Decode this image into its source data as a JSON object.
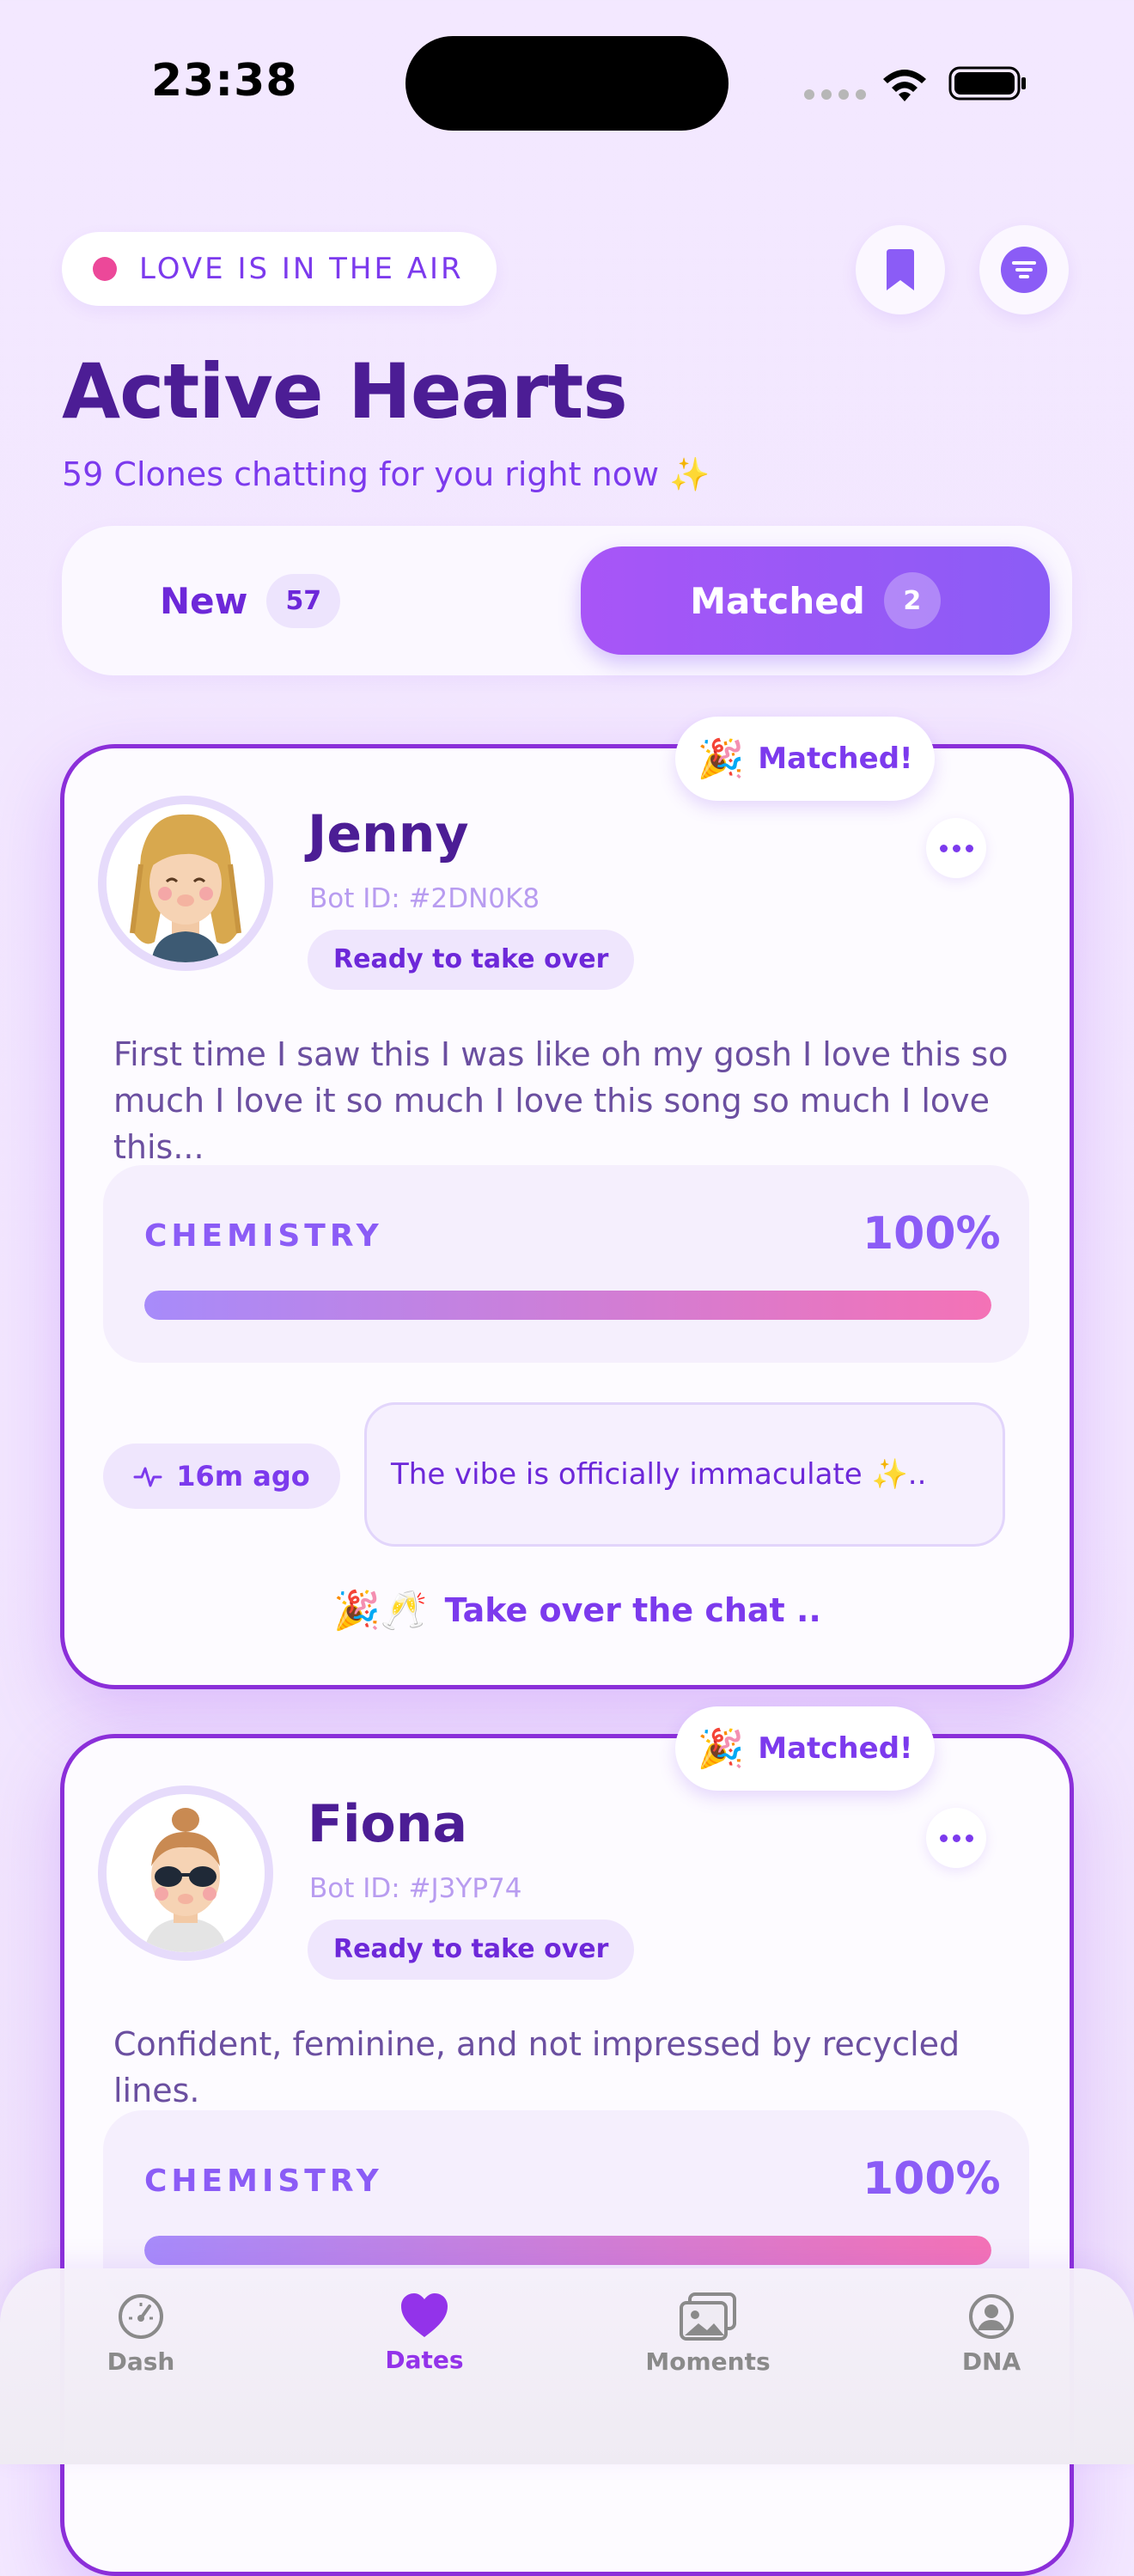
{
  "status_bar": {
    "time": "23:38"
  },
  "header": {
    "tag_label": "LOVE IS IN THE AIR",
    "title": "Active Hearts",
    "subtitle": "59 Clones chatting for you right now ✨"
  },
  "segments": {
    "new_label": "New",
    "new_count": "57",
    "matched_label": "Matched",
    "matched_count": "2"
  },
  "cards": [
    {
      "badge_emoji": "🎉",
      "badge_label": "Matched!",
      "name": "Jenny",
      "bot_id": "Bot ID: #2DN0K8",
      "status": "Ready to take over",
      "description": "First time I saw this I was like oh my gosh I love this so much I love it so much I love this song so much I love this...",
      "chemistry_label": "CHEMISTRY",
      "chemistry_value": "100%",
      "chemistry_fraction": 1.0,
      "last_active": "16m ago",
      "last_message": "The vibe is officially immaculate ✨..",
      "takeover_emoji": "🎉🥂",
      "takeover_label": "Take over the chat  .."
    },
    {
      "badge_emoji": "🎉",
      "badge_label": "Matched!",
      "name": "Fiona",
      "bot_id": "Bot ID: #J3YP74",
      "status": "Ready to take over",
      "description": "Confident, feminine, and not impressed by recycled lines.",
      "chemistry_label": "CHEMISTRY",
      "chemistry_value": "100%",
      "chemistry_fraction": 1.0
    }
  ],
  "tabbar": {
    "items": [
      {
        "label": "Dash",
        "icon": "gauge-icon"
      },
      {
        "label": "Dates",
        "icon": "heart-icon",
        "active": true
      },
      {
        "label": "Moments",
        "icon": "photos-icon"
      },
      {
        "label": "DNA",
        "icon": "profile-icon"
      }
    ]
  },
  "colors": {
    "accent": "#7c3aed",
    "title": "#4c1d95",
    "pink_dot": "#ec4899",
    "card_border": "#8b2fd9"
  }
}
